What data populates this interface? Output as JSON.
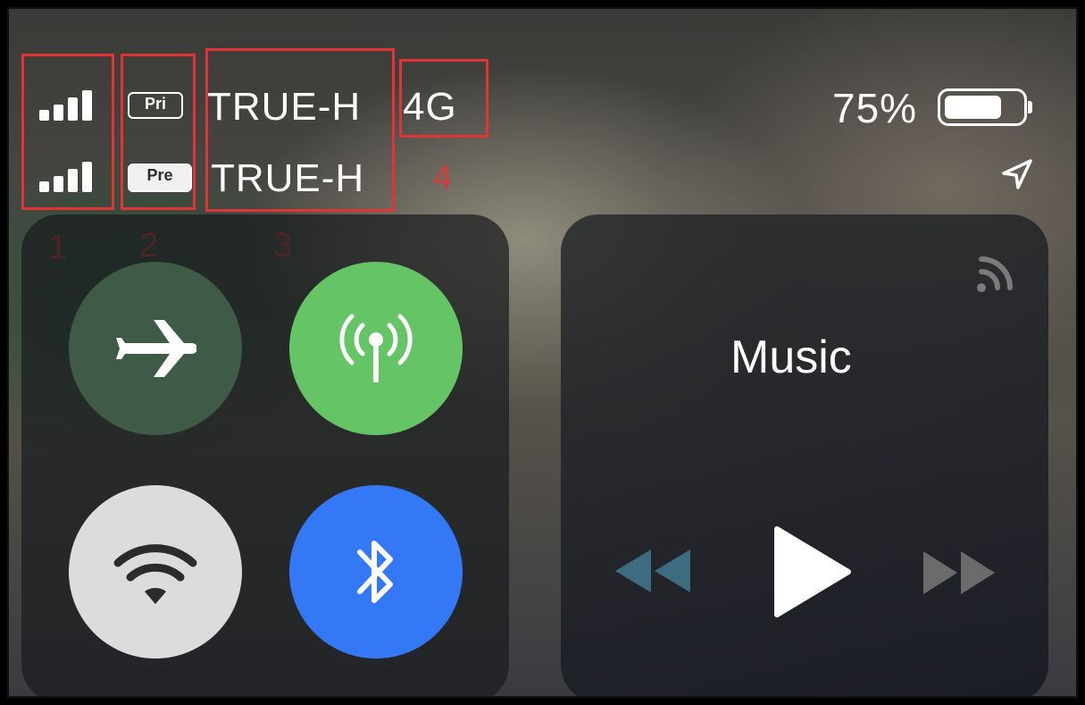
{
  "status": {
    "sim1": {
      "badge": "Pri",
      "carrier": "TRUE-H",
      "network": "4G"
    },
    "sim2": {
      "badge": "Pre",
      "carrier": "TRUE-H"
    },
    "battery_percent_label": "75%",
    "battery_level": 0.75
  },
  "annotations": [
    "1",
    "2",
    "3",
    "4"
  ],
  "connectivity": {
    "airplane_mode": {
      "icon": "airplane-icon",
      "color": "#3f5a47"
    },
    "cellular_data": {
      "icon": "cellular-antenna-icon",
      "color": "#65c466"
    },
    "wifi": {
      "icon": "wifi-icon",
      "color": "#dcdcdc"
    },
    "bluetooth": {
      "icon": "bluetooth-icon",
      "color": "#3478f6"
    }
  },
  "media": {
    "title": "Music",
    "airplay_icon": "airplay-audio-icon"
  },
  "colors": {
    "annotation_red": "#e23434"
  }
}
